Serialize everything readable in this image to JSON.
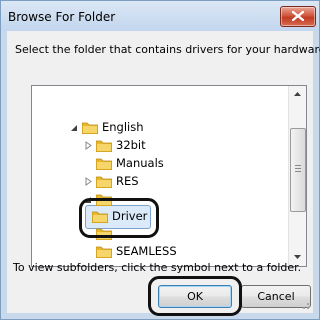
{
  "window": {
    "title": "Browse For Folder"
  },
  "dialog": {
    "prompt": "Select the folder that contains drivers for your hardware.",
    "hint": "To view subfolders, click the symbol next to a folder."
  },
  "tree": {
    "items": [
      {
        "label": "English",
        "expander": "expanded"
      },
      {
        "label": "32bit",
        "expander": "collapsed"
      },
      {
        "label": "Manuals",
        "expander": "none"
      },
      {
        "label": "RES",
        "expander": "collapsed"
      },
      {
        "label": "Driver",
        "expander": "none",
        "selected": true
      },
      {
        "label": "SEAMLESS",
        "expander": "none"
      }
    ]
  },
  "buttons": {
    "ok": "OK",
    "cancel": "Cancel"
  },
  "icons": {
    "close": "close-icon",
    "folder": "folder-icon",
    "expand": "expand-arrow-icon",
    "collapse": "collapse-arrow-icon",
    "scroll_up": "scroll-up-icon",
    "scroll_down": "scroll-down-icon"
  },
  "colors": {
    "title_bar": "#c9d9ec",
    "client": "#f0f0f0",
    "close_button": "#c9452c",
    "selection": "#dbeaf9",
    "folder": "#e8b82a"
  }
}
